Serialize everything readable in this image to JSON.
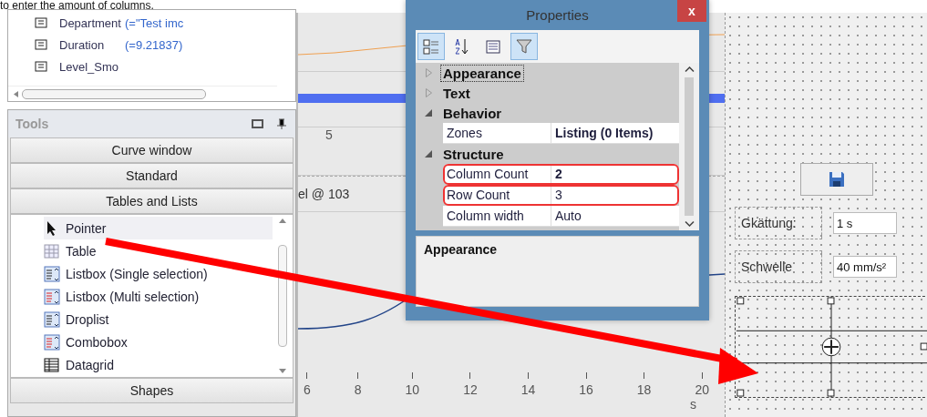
{
  "caption": "to enter the amount of columns.",
  "channel_list": {
    "rows": [
      {
        "name": "Department",
        "value": "(=\"Test imc"
      },
      {
        "name": "Duration",
        "value": "(=9.21837)"
      },
      {
        "name": "Level_Smo"
      }
    ]
  },
  "tools": {
    "title": "Tools",
    "groups": [
      "Curve window",
      "Standard",
      "Tables and Lists"
    ],
    "items": [
      {
        "label": "Pointer",
        "kind": "pointer",
        "selected": true
      },
      {
        "label": "Table",
        "kind": "table",
        "selected": false
      },
      {
        "label": "Listbox (Single selection)",
        "kind": "listbox",
        "selected": false
      },
      {
        "label": "Listbox (Multi selection)",
        "kind": "listbox-multi",
        "selected": false
      },
      {
        "label": "Droplist",
        "kind": "droplist",
        "selected": false
      },
      {
        "label": "Combobox",
        "kind": "combobox",
        "selected": false
      },
      {
        "label": "Datagrid",
        "kind": "datagrid",
        "selected": false
      }
    ],
    "footer_group": "Shapes"
  },
  "curve_window": {
    "upper_tick": "5",
    "legend_label": "el @ 103",
    "x_ticks": [
      "6",
      "8",
      "10",
      "12",
      "14",
      "16",
      "18",
      "20"
    ],
    "x_unit": "s"
  },
  "properties": {
    "title": "Properties",
    "close": "x",
    "toolbar": [
      {
        "kind": "categorized",
        "selected": true
      },
      {
        "kind": "alphabetical",
        "selected": false
      },
      {
        "kind": "pages",
        "selected": false
      },
      {
        "kind": "filter",
        "selected": true
      }
    ],
    "categories": [
      {
        "name": "Appearance",
        "expanded": false,
        "focused": true
      },
      {
        "name": "Text",
        "expanded": false,
        "focused": false
      },
      {
        "name": "Behavior",
        "expanded": true,
        "focused": false,
        "properties": [
          {
            "name": "Zones",
            "value": "Listing (0 Items)",
            "bold": true,
            "highlighted": false
          }
        ]
      },
      {
        "name": "Structure",
        "expanded": true,
        "focused": false,
        "properties": [
          {
            "name": "Column Count",
            "value": "2",
            "bold": true,
            "highlighted": true
          },
          {
            "name": "Row Count",
            "value": "3",
            "bold": false,
            "highlighted": true
          },
          {
            "name": "Column width",
            "value": "Auto",
            "bold": false,
            "highlighted": false
          }
        ]
      }
    ],
    "description_title": "Appearance"
  },
  "design": {
    "fields": [
      {
        "label": "Gkättung:",
        "value": "1 s"
      },
      {
        "label": "Schwelle",
        "value": "40 mm/s²"
      }
    ]
  }
}
